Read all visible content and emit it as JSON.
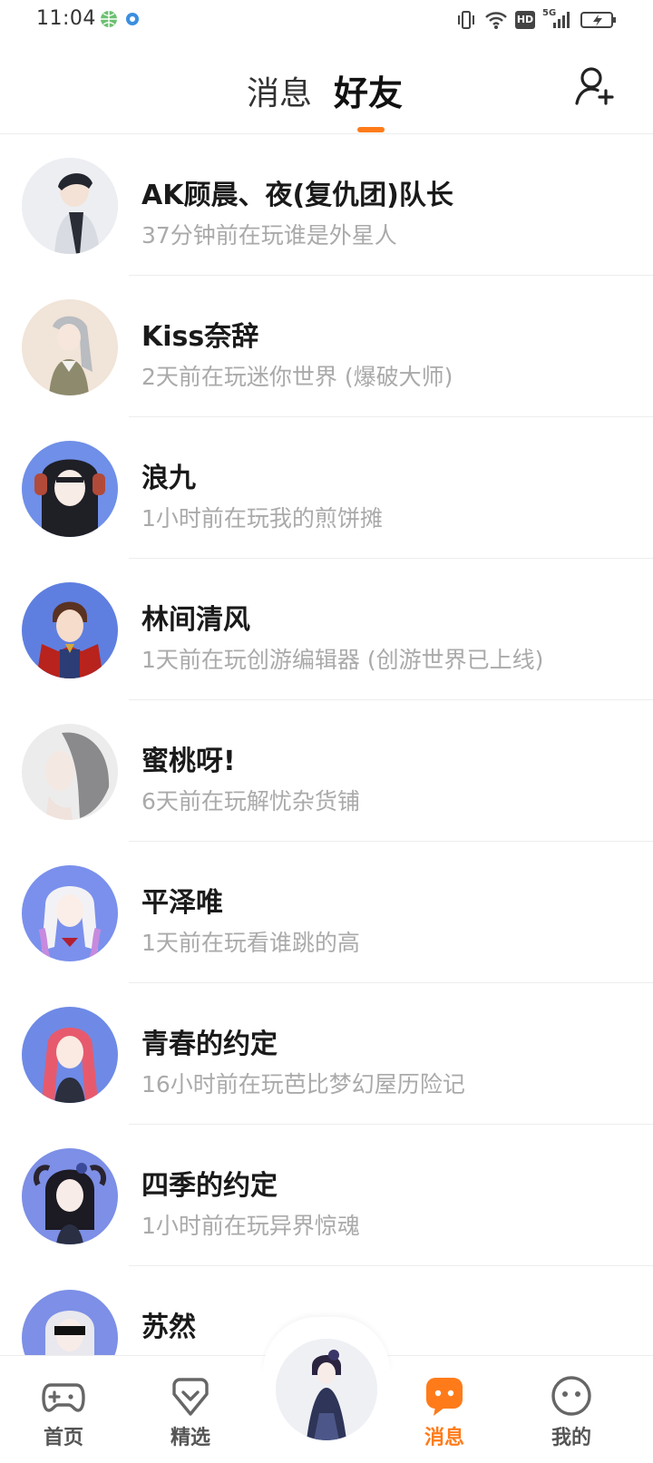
{
  "status_bar": {
    "time": "11:04",
    "network": "5G",
    "hd_badge": "HD",
    "icons": [
      "globe-icon",
      "location-icon",
      "vibrate-icon",
      "wifi-icon",
      "hd-icon",
      "signal-icon",
      "battery-charging-icon"
    ]
  },
  "header": {
    "tabs": [
      {
        "label": "消息",
        "active": false
      },
      {
        "label": "好友",
        "active": true
      }
    ],
    "add_friend_icon": "add-user-icon",
    "accent_color": "#ff7b1a"
  },
  "friends": [
    {
      "name": "AK顾晨、夜(复仇团)队长",
      "status": "37分钟前在玩谁是外星人",
      "avatar_color": "#e9eaee"
    },
    {
      "name": "Kiss奈辞",
      "status": "2天前在玩迷你世界 (爆破大师)",
      "avatar_color": "#f2e6dc"
    },
    {
      "name": "浪九",
      "status": "1小时前在玩我的煎饼摊",
      "avatar_color": "#6f8fe8"
    },
    {
      "name": "林间清风",
      "status": "1天前在玩创游编辑器 (创游世界已上线)",
      "avatar_color": "#5f7fe0"
    },
    {
      "name": "蜜桃呀!",
      "status": "6天前在玩解忧杂货铺",
      "avatar_color": "#dcdcdc"
    },
    {
      "name": "平泽唯",
      "status": "1天前在玩看谁跳的高",
      "avatar_color": "#7a90ec"
    },
    {
      "name": "青春的约定",
      "status": "16小时前在玩芭比梦幻屋历险记",
      "avatar_color": "#6e8ae6"
    },
    {
      "name": "四季的约定",
      "status": "1小时前在玩异界惊魂",
      "avatar_color": "#7d8fe6"
    },
    {
      "name": "苏然",
      "status": "",
      "avatar_color": "#7d8fe6"
    }
  ],
  "bottom_nav": {
    "items": [
      {
        "label": "首页",
        "icon": "gamepad-icon",
        "active": false
      },
      {
        "label": "精选",
        "icon": "heart-badge-icon",
        "active": false
      },
      {
        "label": "消息",
        "icon": "chat-bubble-icon",
        "active": true
      },
      {
        "label": "我的",
        "icon": "smiley-icon",
        "active": false
      }
    ]
  }
}
